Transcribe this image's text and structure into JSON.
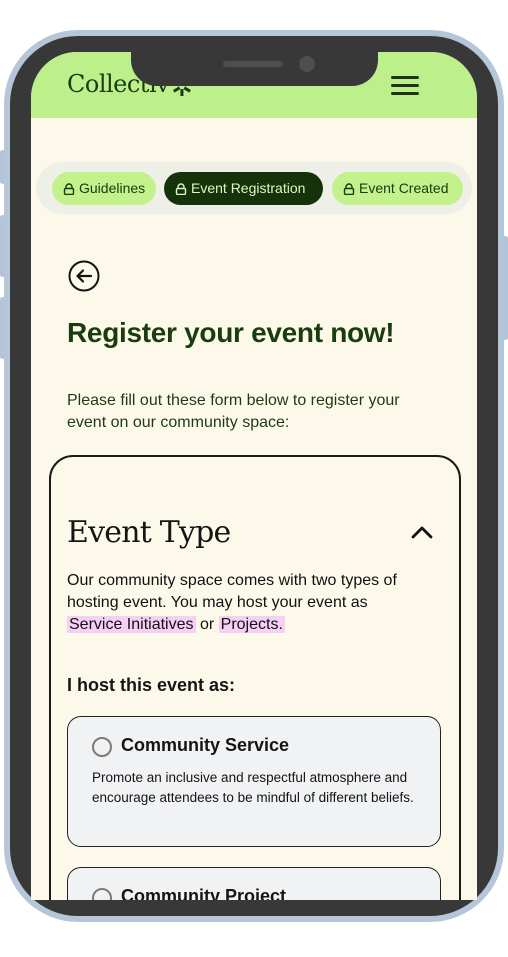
{
  "header": {
    "logo_text": "Collectiv",
    "logo_mark": "✲"
  },
  "steps": [
    {
      "label": "Guidelines",
      "active": false
    },
    {
      "label": "Event Registration",
      "active": true
    },
    {
      "label": "Event Created",
      "active": false
    }
  ],
  "page": {
    "title": "Register your event now!",
    "intro": "Please fill out these form below to register your event on our community space:"
  },
  "event_type": {
    "title": "Event Type",
    "desc_before": "Our community space comes with two types of hosting event. You may host your event as",
    "highlight_1": "Service Initiatives",
    "desc_mid": "or",
    "highlight_2": "Projects.",
    "host_label": "I host this event as:",
    "options": [
      {
        "title": "Community Service",
        "desc": "Promote an inclusive and respectful atmosphere and encourage attendees to be mindful of different beliefs.",
        "selected": false
      },
      {
        "title": "Community Project",
        "desc": "",
        "selected": false
      }
    ]
  },
  "colors": {
    "header_bg": "#bdf08a",
    "page_bg": "#fdf9ea",
    "accent_dark": "#15330a",
    "chip_idle": "#c3f28d",
    "highlight": "#f6cff5"
  },
  "icons": [
    "lock-icon",
    "back-arrow-icon",
    "menu-icon",
    "chevron-up-icon",
    "logo-star-icon"
  ]
}
